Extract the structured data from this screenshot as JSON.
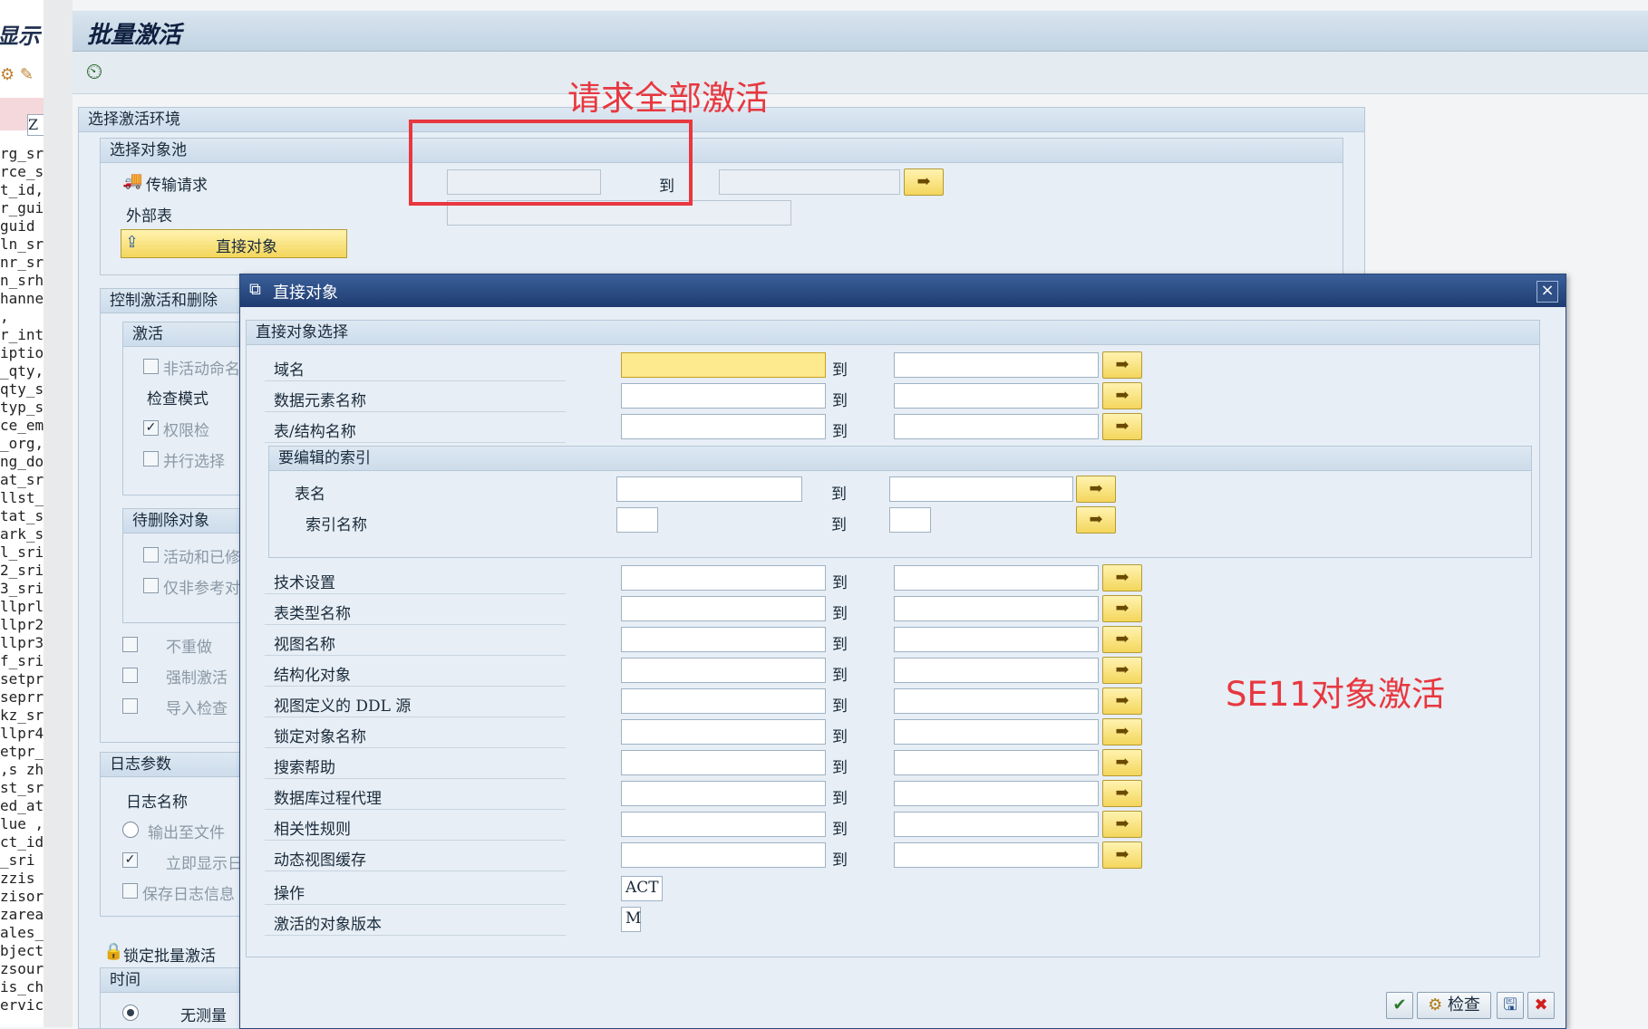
{
  "left_strip": {
    "title_fragment": "显示",
    "z_field": "Z",
    "code_lines": [
      "rg_sr",
      "rce_s",
      "t_id,",
      "r_gui",
      "guid",
      "ln_sr",
      "nr_sr",
      "n_srh",
      "hanne",
      ",",
      "r_int",
      "iptio",
      "_qty,",
      "qty_s",
      "typ_s",
      "ce_em",
      "_org,",
      "ng_do",
      "at_sr",
      "llst_",
      "tat_s",
      "ark_s",
      "l_sri",
      "2_sri",
      "3_sri",
      "llprl",
      "llpr2",
      "llpr3",
      "f_sri",
      "setpr",
      "seprr",
      "kz_sr",
      "llpr4",
      "etpr_",
      ",s zh",
      "st_sr",
      "ed_at",
      "lue ,",
      "ct_id",
      "_sri",
      "zzis",
      "zisor",
      "zarea",
      "ales_",
      "bject",
      "zsour",
      "is_ch",
      "ervic"
    ]
  },
  "main": {
    "title": "批量激活",
    "env_section": {
      "title": "选择激活环境"
    },
    "pool_section": {
      "title": "选择对象池",
      "transport_label": "传输请求",
      "to": "到",
      "external_label": "外部表",
      "direct_button": "直接对象"
    },
    "control_section": {
      "title": "控制激活和删除",
      "activate_group": "激活",
      "inactive_name": "非活动命名",
      "check_mode": "检查模式",
      "auth_check": "权限检",
      "parallel": "并行选择",
      "delete_group": "待删除对象",
      "active_changed": "活动和已修",
      "non_ref": "仅非参考对",
      "no_redo": "不重做",
      "force": "强制激活",
      "import_check": "导入检查"
    },
    "log_section": {
      "title": "日志参数",
      "log_name": "日志名称",
      "to_file": "输出至文件",
      "show_now": "立即显示日",
      "save_log": "保存日志信息"
    },
    "lock_label": "锁定批量激活",
    "time_section": {
      "title": "时间",
      "no_measure": "无测量"
    }
  },
  "annotations": {
    "request_all": "请求全部激活",
    "se11": "SE11对象激活",
    "color": "#e8373f"
  },
  "dialog": {
    "title": "直接对象",
    "section_title": "直接对象选择",
    "to": "到",
    "rows_top": [
      {
        "label": "域名"
      },
      {
        "label": "数据元素名称"
      },
      {
        "label": "表/结构名称"
      }
    ],
    "index_group": {
      "title": "要编辑的索引",
      "table_name": "表名",
      "index_name": "索引名称"
    },
    "rows_bottom": [
      {
        "label": "技术设置"
      },
      {
        "label": "表类型名称"
      },
      {
        "label": "视图名称"
      },
      {
        "label": "结构化对象"
      },
      {
        "label": "视图定义的 DDL 源"
      },
      {
        "label": "锁定对象名称"
      },
      {
        "label": "搜索帮助"
      },
      {
        "label": "数据库过程代理"
      },
      {
        "label": "相关性规则"
      },
      {
        "label": "动态视图缓存"
      }
    ],
    "operation_label": "操作",
    "operation_value": "ACT",
    "version_label": "激活的对象版本",
    "version_value": "M",
    "footer": {
      "check_label": "检查"
    }
  },
  "colors": {
    "sap_blue_title": "#1e3c70",
    "multi_select_yellow": "#f4d65c",
    "focus_yellow": "#fde98e"
  }
}
